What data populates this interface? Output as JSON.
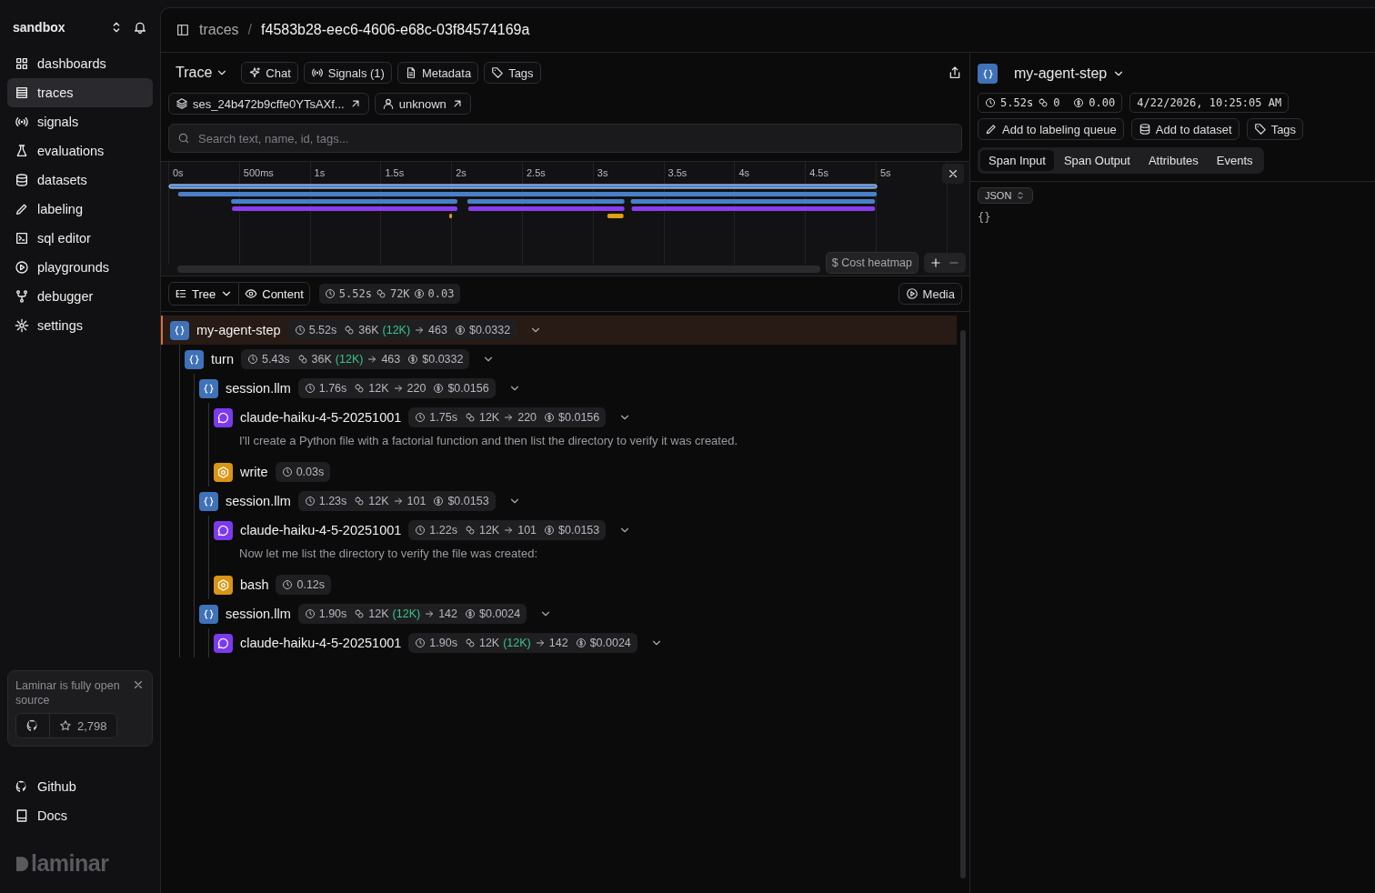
{
  "sidebar": {
    "workspace": "sandbox",
    "items": [
      {
        "label": "dashboards",
        "selected": false
      },
      {
        "label": "traces",
        "selected": true
      },
      {
        "label": "signals",
        "selected": false
      },
      {
        "label": "evaluations",
        "selected": false
      },
      {
        "label": "datasets",
        "selected": false
      },
      {
        "label": "labeling",
        "selected": false
      },
      {
        "label": "sql editor",
        "selected": false
      },
      {
        "label": "playgrounds",
        "selected": false
      },
      {
        "label": "debugger",
        "selected": false
      },
      {
        "label": "settings",
        "selected": false
      }
    ],
    "promo": {
      "text": "Laminar is fully open source",
      "star_count": "2,798"
    },
    "links": [
      "Github",
      "Docs"
    ],
    "logo": "laminar"
  },
  "breadcrumb": {
    "parent": "traces",
    "separator": "/",
    "current": "f4583b28-eec6-4606-e68c-03f84574169a"
  },
  "toolbar": {
    "title": "Trace",
    "buttons": [
      "Chat",
      "Signals (1)",
      "Metadata",
      "Tags"
    ],
    "links": [
      "ses_24b472b9cffe0YTsAXf...",
      "unknown"
    ]
  },
  "search": {
    "placeholder": "Search text, name, id, tags..."
  },
  "timeline": {
    "ticks": [
      "0s",
      "500ms",
      "1s",
      "1.5s",
      "2s",
      "2.5s",
      "3s",
      "3.5s",
      "4s",
      "4.5s",
      "5s"
    ],
    "cost_heatmap": "$ Cost heatmap"
  },
  "view": {
    "tree": "Tree",
    "content": "Content",
    "duration": "5.52s",
    "tokens": "72K",
    "cost": "0.03",
    "media": "Media"
  },
  "spans": [
    {
      "kind": "default",
      "name": "my-agent-step",
      "selected": true,
      "duration": "5.52s",
      "tokens": "36K",
      "cached": "(12K)",
      "output": "463",
      "cost": "$0.0332",
      "children": [
        {
          "kind": "default",
          "name": "turn",
          "selected": false,
          "duration": "5.43s",
          "tokens": "36K",
          "cached": "(12K)",
          "output": "463",
          "cost": "$0.0332",
          "children": [
            {
              "kind": "default",
              "name": "session.llm",
              "selected": false,
              "duration": "1.76s",
              "tokens": "12K",
              "output": "220",
              "cost": "$0.0156",
              "children": [
                {
                  "kind": "llm",
                  "name": "claude-haiku-4-5-20251001",
                  "selected": false,
                  "duration": "1.75s",
                  "tokens": "12K",
                  "output": "220",
                  "cost": "$0.0156",
                  "preview": "I'll create a Python file with a factorial function and then list the directory to verify it was created."
                },
                {
                  "kind": "tool",
                  "name": "write",
                  "selected": false,
                  "duration": "0.03s"
                }
              ]
            },
            {
              "kind": "default",
              "name": "session.llm",
              "selected": false,
              "duration": "1.23s",
              "tokens": "12K",
              "output": "101",
              "cost": "$0.0153",
              "children": [
                {
                  "kind": "llm",
                  "name": "claude-haiku-4-5-20251001",
                  "selected": false,
                  "duration": "1.22s",
                  "tokens": "12K",
                  "output": "101",
                  "cost": "$0.0153",
                  "preview": "Now let me list the directory to verify the file was created:"
                },
                {
                  "kind": "tool",
                  "name": "bash",
                  "selected": false,
                  "duration": "0.12s"
                }
              ]
            },
            {
              "kind": "default",
              "name": "session.llm",
              "selected": false,
              "duration": "1.90s",
              "tokens": "12K",
              "cached": "(12K)",
              "output": "142",
              "cost": "$0.0024",
              "children": [
                {
                  "kind": "llm",
                  "name": "claude-haiku-4-5-20251001",
                  "selected": false,
                  "duration": "1.90s",
                  "tokens": "12K",
                  "cached": "(12K)",
                  "output": "142",
                  "cost": "$0.0024"
                }
              ]
            }
          ]
        }
      ]
    }
  ],
  "detail": {
    "kind": "default",
    "name": "my-agent-step",
    "duration": "5.52s",
    "tokens": "0",
    "cost": "0.00",
    "date": "4/22/2026, 10:25:05 AM",
    "actions": [
      "Add to labeling queue",
      "Add to dataset",
      "Tags"
    ],
    "tabs": [
      {
        "label": "Span Input",
        "selected": true
      },
      {
        "label": "Span Output",
        "selected": false
      },
      {
        "label": "Attributes",
        "selected": false
      },
      {
        "label": "Events",
        "selected": false
      }
    ],
    "format": "JSON",
    "content": "{}"
  }
}
